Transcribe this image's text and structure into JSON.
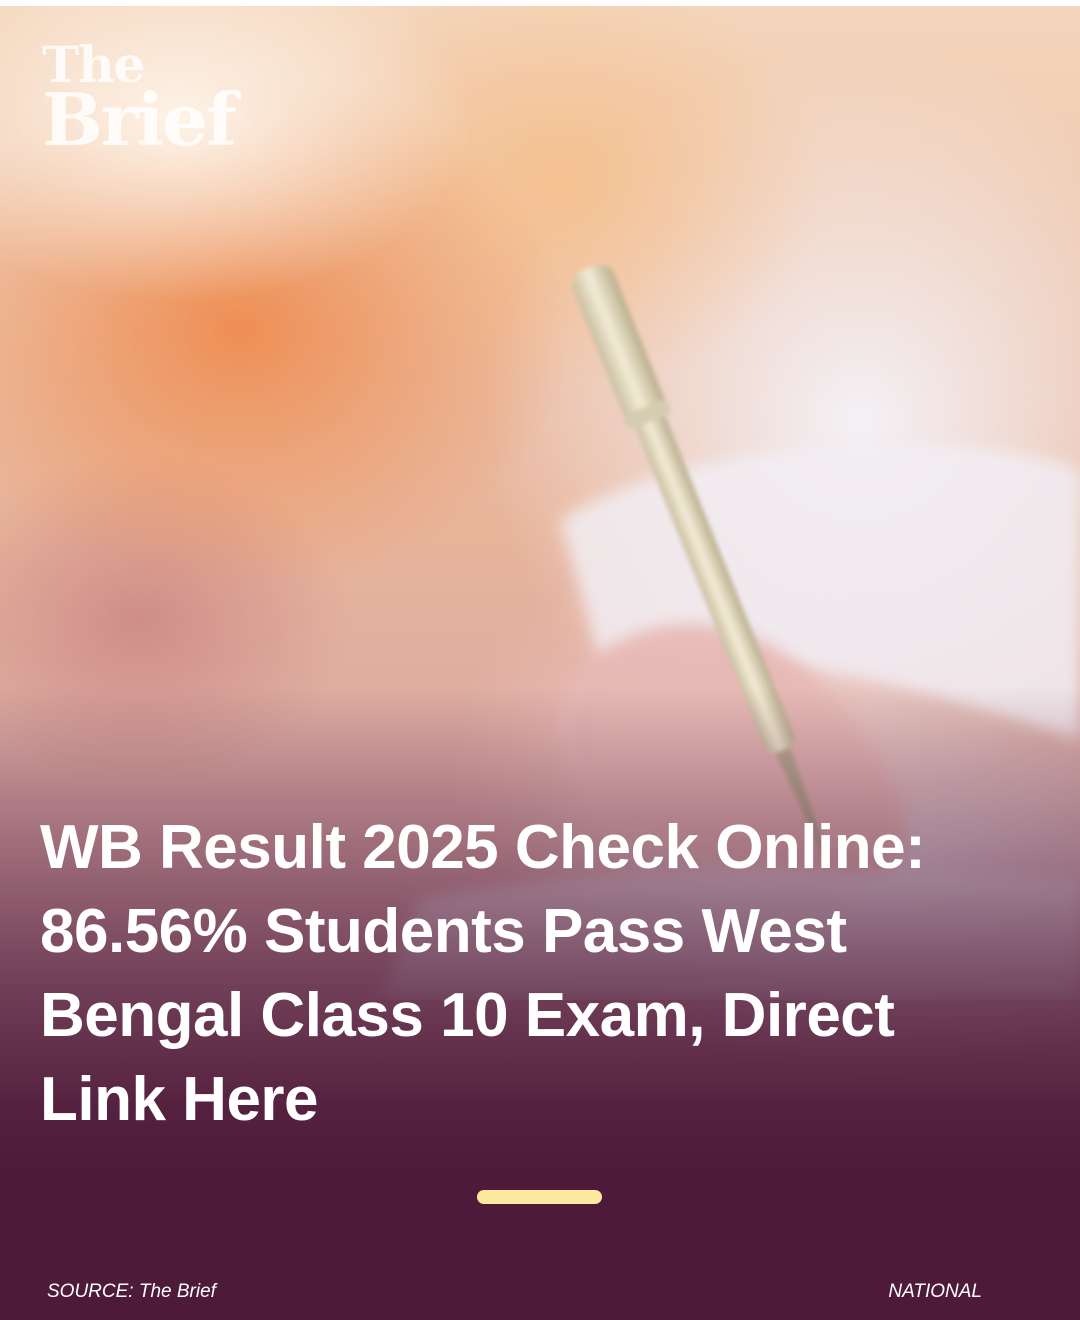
{
  "brand": {
    "logo_top": "The",
    "logo_bottom": "Brief"
  },
  "article": {
    "headline": "WB Result 2025 Check Online: 86.56% Students Pass West Bengal Class 10 Exam, Direct Link Here"
  },
  "footer": {
    "source": "SOURCE: The Brief",
    "category": "NATIONAL"
  },
  "colors": {
    "background_overlay": "#4e1a3a",
    "accent_bar": "#fdeaa0",
    "text": "#ffffff"
  }
}
